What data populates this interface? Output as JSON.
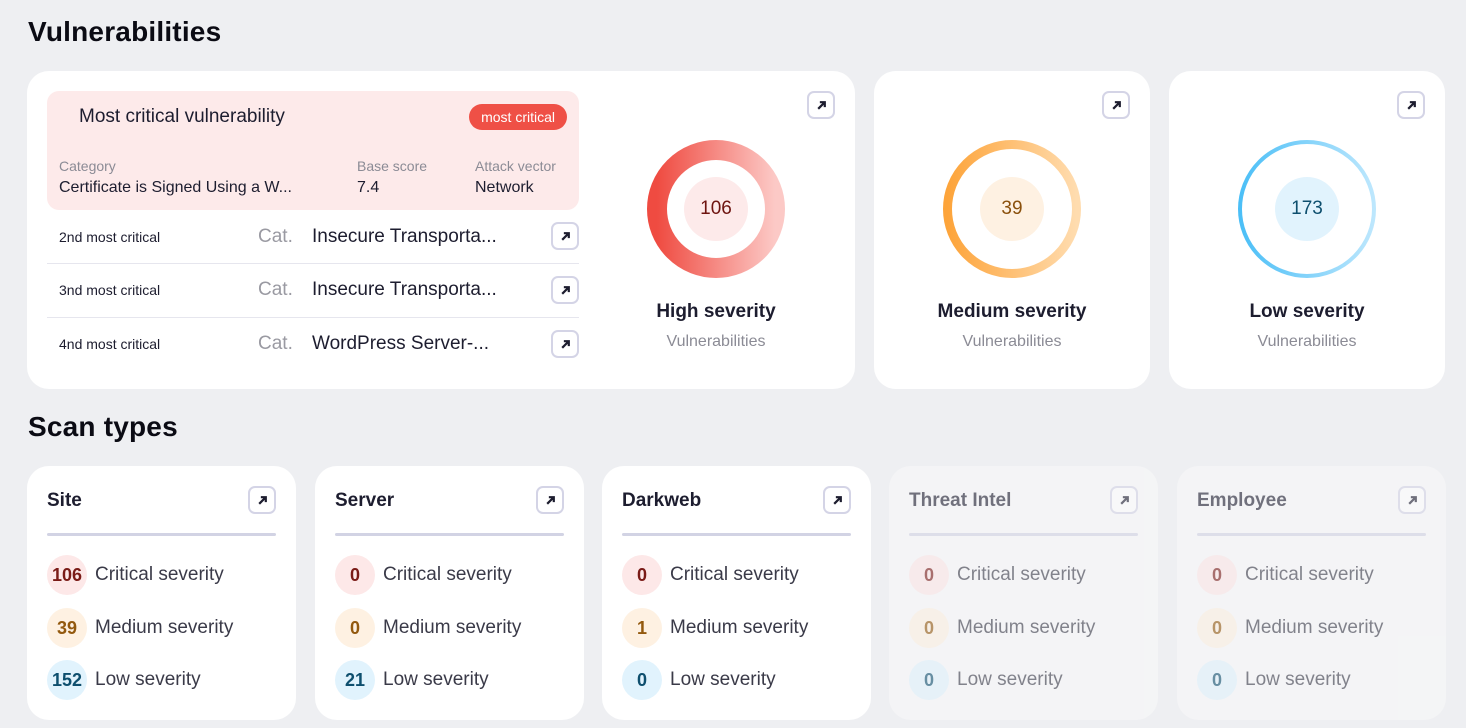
{
  "vulnerabilities": {
    "section_title": "Vulnerabilities",
    "most_critical": {
      "title": "Most critical vulnerability",
      "badge": "most critical",
      "category_label": "Category",
      "category_value": "Certificate is Signed Using a W...",
      "base_score_label": "Base score",
      "base_score_value": "7.4",
      "attack_vector_label": "Attack vector",
      "attack_vector_value": "Network"
    },
    "critical_list": [
      {
        "rank": "2nd most critical",
        "cat_label": "Cat.",
        "name": "Insecure Transporta..."
      },
      {
        "rank": "3nd most critical",
        "cat_label": "Cat.",
        "name": "Insecure Transporta..."
      },
      {
        "rank": "4nd most critical",
        "cat_label": "Cat.",
        "name": "WordPress Server-..."
      }
    ],
    "severity": {
      "high": {
        "count": "106",
        "title": "High severity",
        "subtitle": "Vulnerabilities",
        "ring_from": "#ef4b41",
        "ring_to": "#fcc9c6",
        "center_bg": "#fdeaea",
        "text_color": "#6e1410"
      },
      "medium": {
        "count": "39",
        "title": "Medium severity",
        "subtitle": "Vulnerabilities",
        "ring_from": "#fda43a",
        "ring_to": "#ffdcaf",
        "center_bg": "#fef1e2",
        "text_color": "#8a500c"
      },
      "low": {
        "count": "173",
        "title": "Low severity",
        "subtitle": "Vulnerabilities",
        "ring_from": "#4bbff7",
        "ring_to": "#bde7fd",
        "center_bg": "#e1f3fd",
        "text_color": "#0e4f6e"
      }
    }
  },
  "scan_types": {
    "section_title": "Scan types",
    "labels": {
      "critical": "Critical severity",
      "medium": "Medium severity",
      "low": "Low severity"
    },
    "cards": [
      {
        "name": "Site",
        "critical": "106",
        "medium": "39",
        "low": "152",
        "enabled": true
      },
      {
        "name": "Server",
        "critical": "0",
        "medium": "0",
        "low": "21",
        "enabled": true
      },
      {
        "name": "Darkweb",
        "critical": "0",
        "medium": "1",
        "low": "0",
        "enabled": true
      },
      {
        "name": "Threat Intel",
        "critical": "0",
        "medium": "0",
        "low": "0",
        "enabled": false
      },
      {
        "name": "Employee",
        "critical": "0",
        "medium": "0",
        "low": "0",
        "enabled": false
      }
    ]
  },
  "icons": {
    "open": "arrow-up-right-icon"
  }
}
